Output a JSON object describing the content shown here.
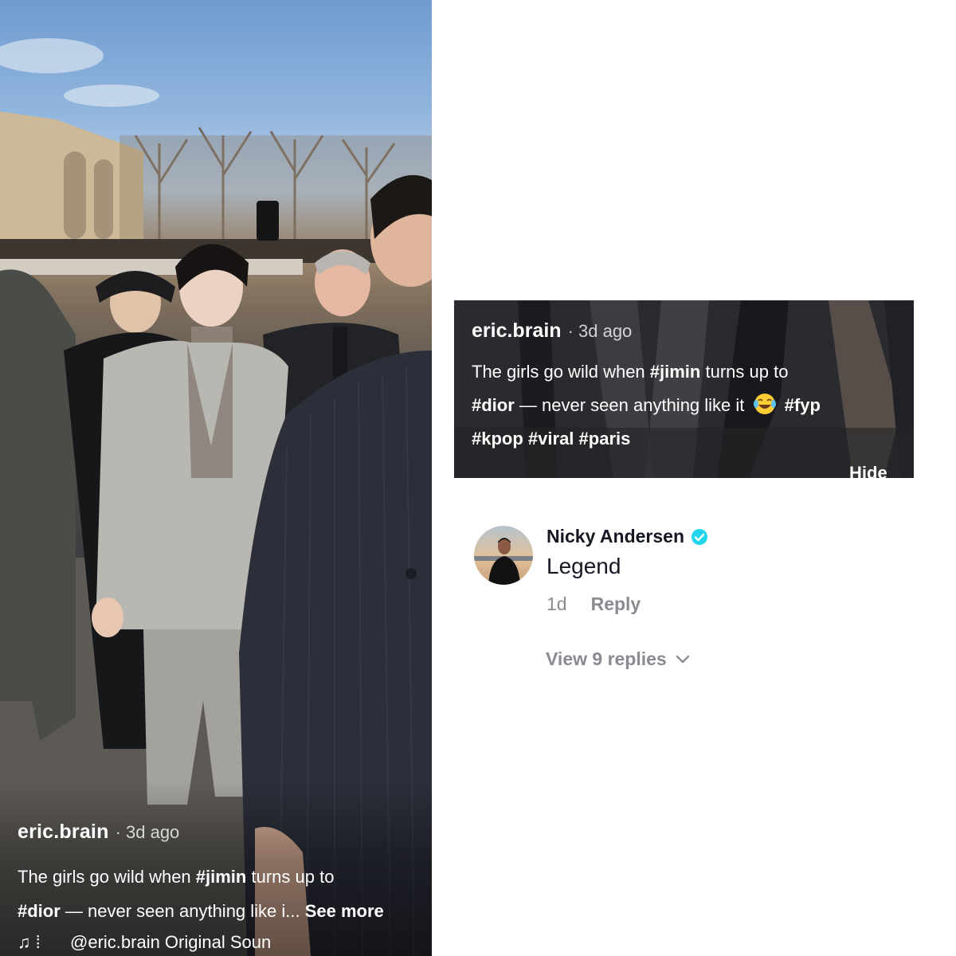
{
  "video": {
    "username": "eric.brain",
    "time": "· 3d ago",
    "caption": {
      "part1": "The girls go wild when ",
      "tag1": "#jimin",
      "part2": " turns up to",
      "tag2": "#dior",
      "part3": " — never seen anything like i...",
      "see_more": " See more"
    },
    "music_icon": "music-note-icon",
    "sound": "@eric.brain Original Soun"
  },
  "caption_card": {
    "username": "eric.brain",
    "time": "· 3d ago",
    "text_part1": "The girls go wild when ",
    "tag_jimin": "#jimin",
    "text_part2": " turns up to",
    "tag_dior": "#dior",
    "text_part3": " — never seen anything like it",
    "emoji": "laughing-tears-emoji",
    "tag_fyp": "#fyp",
    "tag_kpop": "#kpop",
    "tag_viral": "#viral",
    "tag_paris": "#paris",
    "hide": "Hide"
  },
  "comment": {
    "author": "Nicky Andersen",
    "verified_icon": "verified-badge-icon",
    "text": "Legend",
    "age": "1d",
    "reply": "Reply",
    "view_replies": "View 9 replies",
    "expand_icon": "chevron-down-icon"
  },
  "colors": {
    "verified": "#20d5ec",
    "meta_text": "#8a8b91",
    "primary_text": "#161823"
  }
}
